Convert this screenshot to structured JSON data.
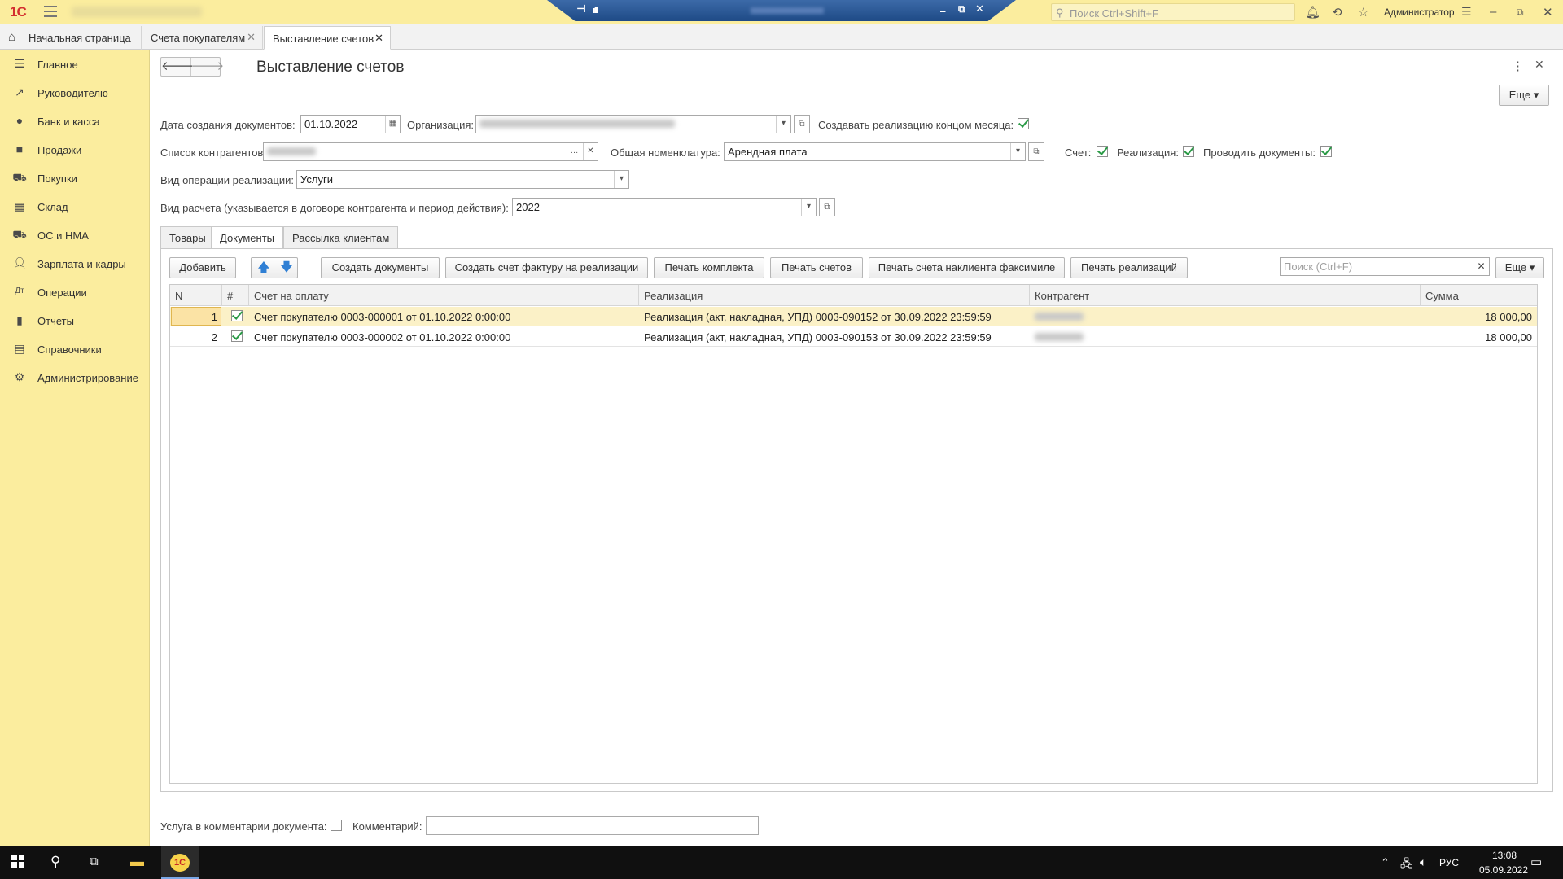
{
  "app": {
    "logo": "1С",
    "rdp_pin": "⊣",
    "rdp_signal": "ıll",
    "search_placeholder": "Поиск Ctrl+Shift+F",
    "user_name": "Администратор"
  },
  "tabs": [
    {
      "label": "Начальная страница"
    },
    {
      "label": "Счета покупателям"
    },
    {
      "label": "Выставление счетов"
    }
  ],
  "sidebar": {
    "items": [
      {
        "label": "Главное",
        "icon": "menu-lines-icon"
      },
      {
        "label": "Руководителю",
        "icon": "trend-icon"
      },
      {
        "label": "Банк и касса",
        "icon": "coin-icon"
      },
      {
        "label": "Продажи",
        "icon": "bag-icon"
      },
      {
        "label": "Покупки",
        "icon": "cart-icon"
      },
      {
        "label": "Склад",
        "icon": "warehouse-icon"
      },
      {
        "label": "ОС и НМА",
        "icon": "truck-icon"
      },
      {
        "label": "Зарплата и кадры",
        "icon": "person-icon"
      },
      {
        "label": "Операции",
        "icon": "operations-icon"
      },
      {
        "label": "Отчеты",
        "icon": "bar-chart-icon"
      },
      {
        "label": "Справочники",
        "icon": "book-icon"
      },
      {
        "label": "Администрирование",
        "icon": "gear-icon"
      }
    ]
  },
  "form": {
    "title": "Выставление счетов",
    "more_label": "Еще",
    "doc_date_label": "Дата создания документов:",
    "doc_date_value": "01.10.2022",
    "org_label": "Организация:",
    "create_month_end_label": "Создавать реализацию концом месяца:",
    "create_month_end_checked": true,
    "counterparties_label": "Список контрагентов:",
    "nomenclature_label": "Общая номенклатура:",
    "nomenclature_value": "Арендная плата",
    "invoice_label": "Счет:",
    "invoice_checked": true,
    "sale_label": "Реализация:",
    "sale_checked": true,
    "post_label": "Проводить документы:",
    "post_checked": true,
    "operation_label": "Вид операции реализации:",
    "operation_value": "Услуги",
    "calc_label": "Вид расчета (указывается в договоре контрагента и период действия):",
    "calc_value": "2022"
  },
  "form_tabs": [
    {
      "label": "Товары",
      "active": false
    },
    {
      "label": "Документы",
      "active": true
    },
    {
      "label": "Рассылка клиентам",
      "active": false
    }
  ],
  "toolbar": {
    "add": "Добавить",
    "create_docs": "Создать документы",
    "create_invoice_facture": "Создать счет фактуру на реализации",
    "print_set": "Печать комплекта",
    "print_invoices": "Печать счетов",
    "print_facsimile": "Печать счета наклиента факсимиле",
    "print_sales": "Печать реализаций",
    "search_placeholder": "Поиск (Ctrl+F)",
    "more": "Еще"
  },
  "table": {
    "columns": [
      "N",
      "#",
      "Счет на оплату",
      "Реализация",
      "Контрагент",
      "Сумма"
    ],
    "rows": [
      {
        "n": "1",
        "checked": true,
        "invoice": "Счет покупателю 0003-000001 от 01.10.2022 0:00:00",
        "sale": "Реализация (акт, накладная, УПД) 0003-090152 от 30.09.2022 23:59:59",
        "amount": "18 000,00"
      },
      {
        "n": "2",
        "checked": true,
        "invoice": "Счет покупателю 0003-000002 от 01.10.2022 0:00:00",
        "sale": "Реализация (акт, накладная, УПД) 0003-090153 от 30.09.2022 23:59:59",
        "amount": "18 000,00"
      }
    ]
  },
  "bottom": {
    "service_in_comment_label": "Услуга в комментарии документа:",
    "service_in_comment_checked": false,
    "comment_label": "Комментарий:",
    "comment_value": ""
  },
  "taskbar": {
    "lang": "РУС",
    "time": "13:08",
    "date": "05.09.2022"
  }
}
